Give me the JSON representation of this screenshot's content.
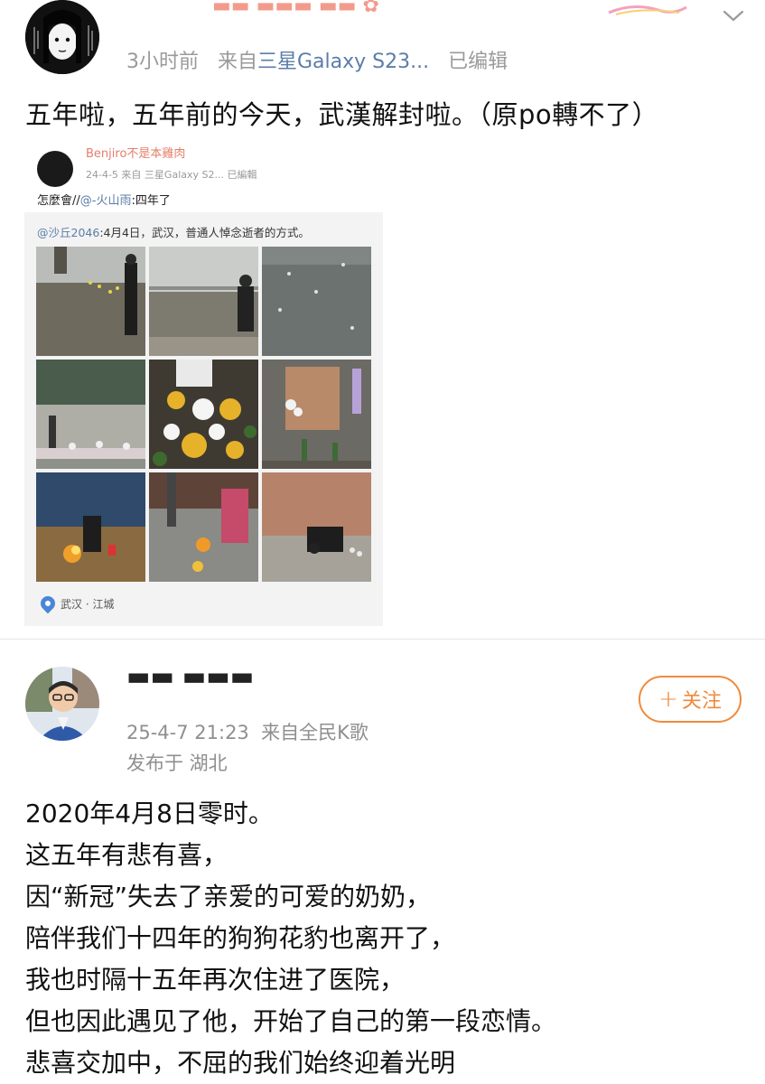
{
  "post1": {
    "meta_time": "3小时前",
    "meta_from": "来自",
    "meta_source": "三星Galaxy S23...",
    "meta_edited": "已编辑",
    "text": "五年啦，五年前的今天，武漢解封啦。（原po轉不了）",
    "embedded": {
      "name": "Benjiro不是本雞肉",
      "meta": "24-4-5   来自 三星Galaxy S2...   已編輯",
      "text_prefix": "怎麼會//",
      "text_mention": "@-火山雨",
      "text_suffix": ":四年了",
      "retweet_mention": "@沙丘2046",
      "retweet_text": ":4月4日，武汉，普通人悼念逝者的方式。",
      "location": "武汉 · 江城"
    }
  },
  "post2": {
    "meta_datetime": "25-4-7 21:23",
    "meta_from": "来自全民K歌",
    "meta_location": "发布于  湖北",
    "follow_plus": "+",
    "follow_label": "关注",
    "body_lines": [
      "2020年4月8日零时。",
      "这五年有悲有喜，",
      "因“新冠”失去了亲爱的可爱的奶奶，",
      "陪伴我们十四年的狗狗花豹也离开了，",
      "我也时隔十五年再次住进了医院，",
      "但也因此遇见了他，开始了自己的第一段恋情。",
      "悲喜交加中，不屈的我们始终迎着光明"
    ]
  },
  "icons": {
    "chevron": "chevron-down-icon",
    "location": "location-pin-icon"
  },
  "colors": {
    "link": "#5b7da8",
    "follow": "#f08a3c",
    "meta": "#9a9a9a"
  }
}
